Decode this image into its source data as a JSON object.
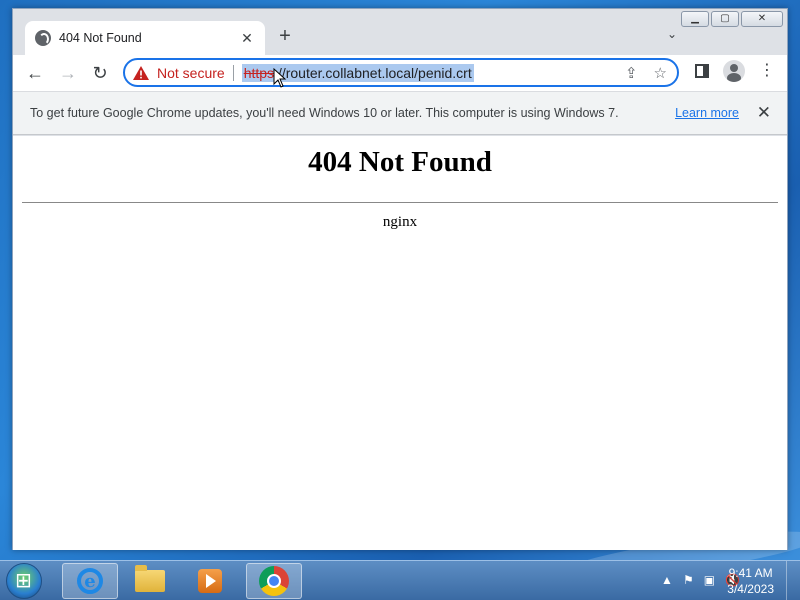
{
  "browser": {
    "tab": {
      "title": "404 Not Found",
      "close_glyph": "✕",
      "favicon": "globe-icon"
    },
    "new_tab_glyph": "+",
    "tab_search_glyph": "⌄",
    "window_controls": {
      "minimize": "▁",
      "maximize": "▢",
      "close": "✕"
    },
    "toolbar": {
      "back_glyph": "←",
      "forward_glyph": "→",
      "reload_glyph": "↻",
      "security_label": "Not secure",
      "url_scheme": "https",
      "url_rest": "://router.collabnet.local/penid.crt",
      "share_glyph": "⇪",
      "bookmark_glyph": "☆",
      "menu_glyph": "⋮"
    },
    "infobar": {
      "message": "To get future Google Chrome updates, you'll need Windows 10 or later. This computer is using Windows 7.",
      "learn_more": "Learn more",
      "close_glyph": "✕"
    }
  },
  "page": {
    "heading": "404 Not Found",
    "server": "nginx"
  },
  "taskbar": {
    "items": [
      "internet-explorer",
      "windows-explorer",
      "media-player",
      "google-chrome"
    ],
    "tray": {
      "show_hidden": "▲",
      "flag": "⚑",
      "network": "▣",
      "volume": "🔇"
    },
    "time": "9:41 AM",
    "date": "3/4/2023"
  },
  "colors": {
    "accent": "#1a73e8",
    "warning": "#c5221f",
    "selection": "#abc9ef"
  }
}
